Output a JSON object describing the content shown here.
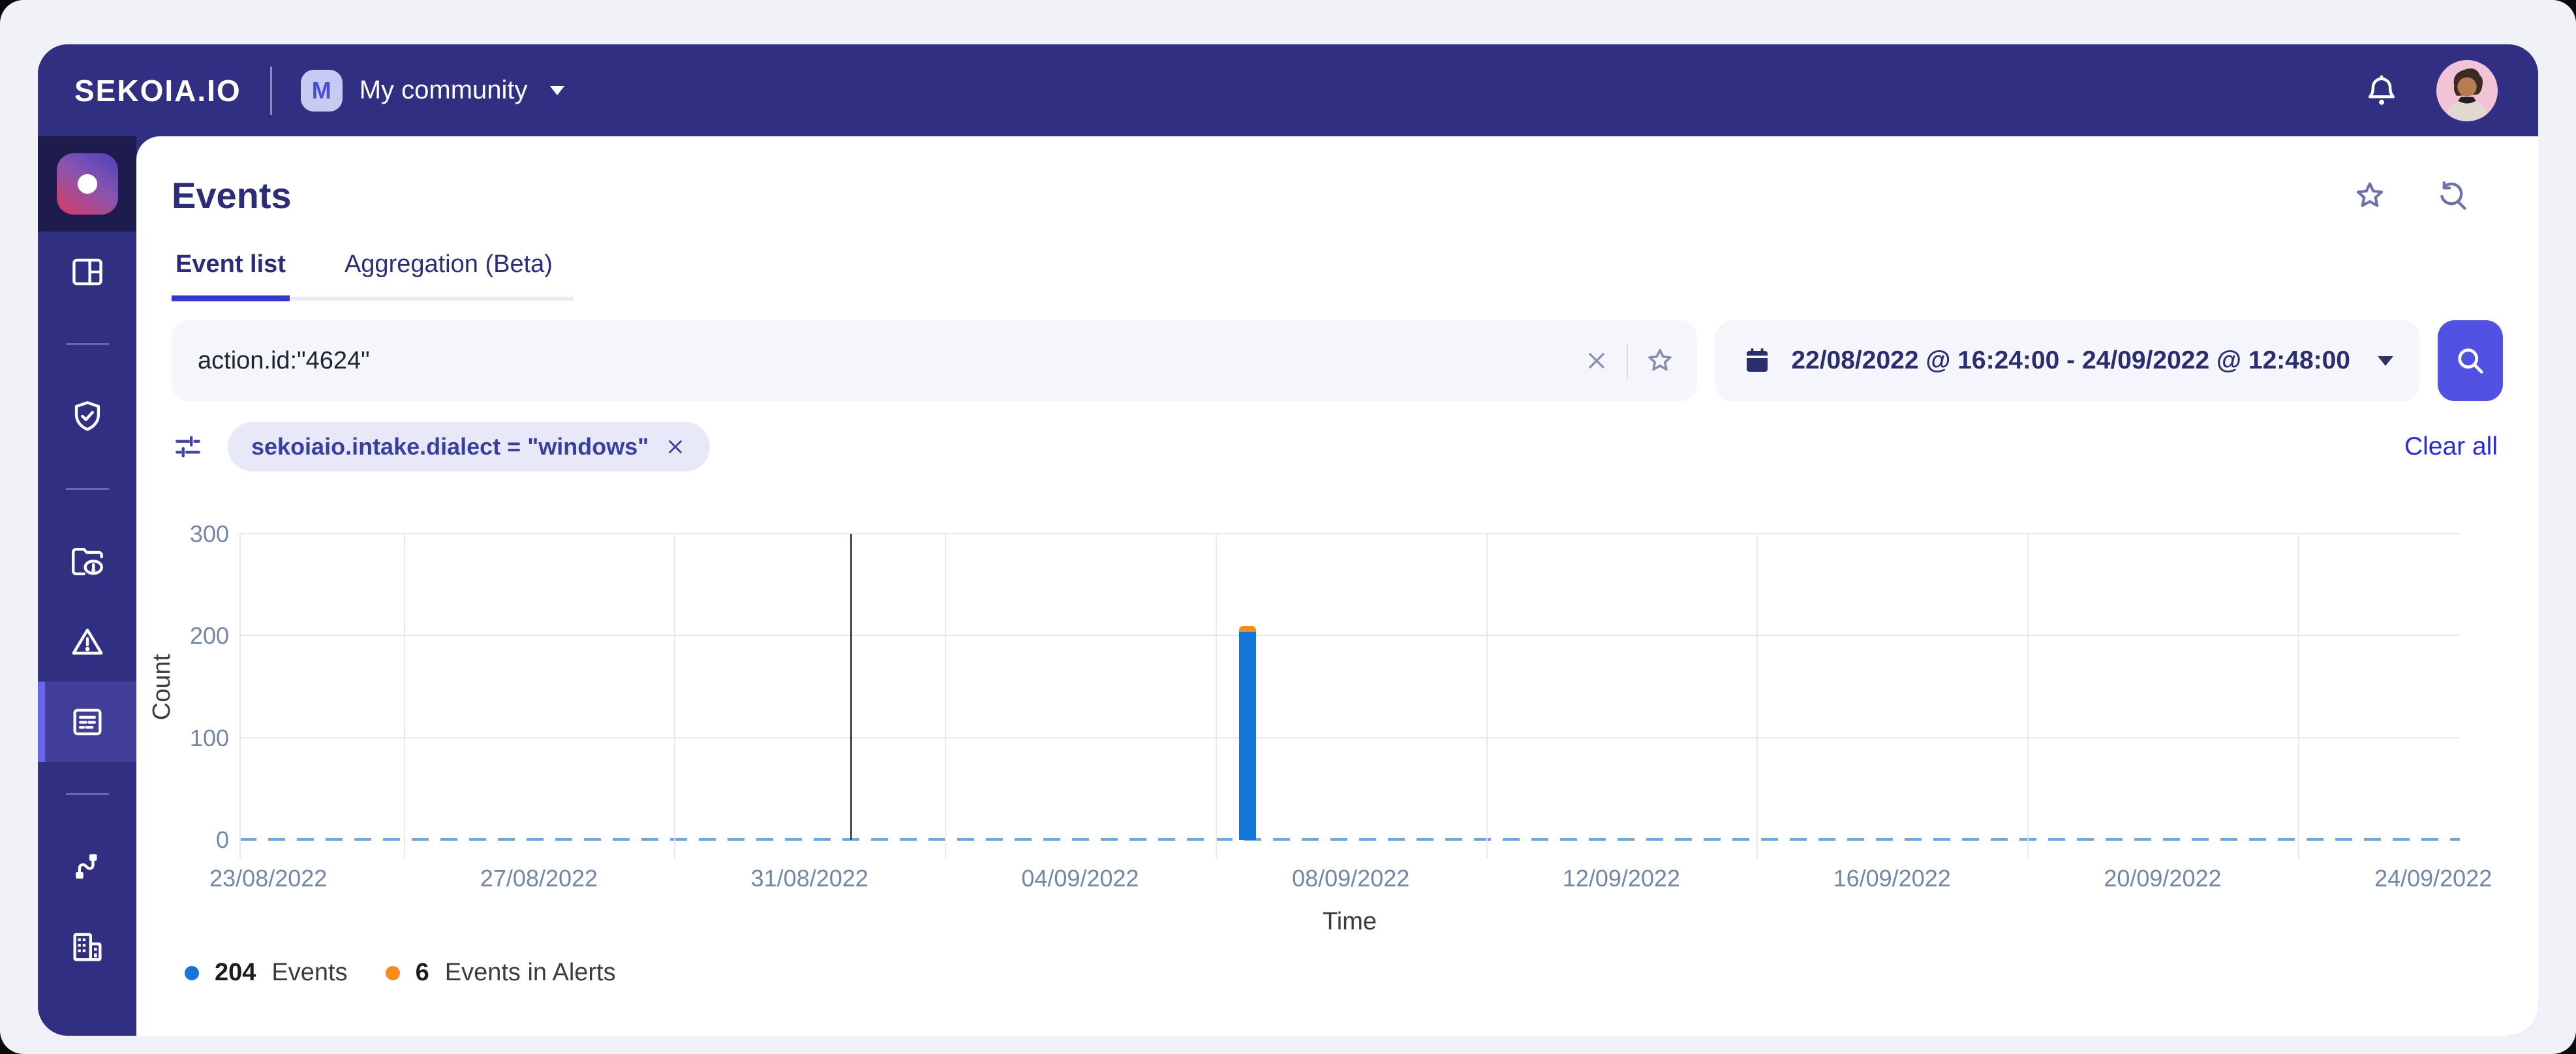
{
  "topbar": {
    "brand": "SEKOIA.IO",
    "community_initial": "M",
    "community_name": "My community",
    "icons": [
      "bell-icon",
      "user-avatar"
    ]
  },
  "sidebar": {
    "icons": [
      "app-logo",
      "dashboard-icon",
      "shield-check-icon",
      "folder-alert-icon",
      "alert-triangle-icon",
      "events-list-icon",
      "intake-plug-icon",
      "organization-building-icon"
    ],
    "active_icon": "events-list-icon"
  },
  "header": {
    "title": "Events",
    "icons": [
      "star-icon",
      "search-history-icon"
    ]
  },
  "tabs": [
    {
      "label": "Event list",
      "active": true
    },
    {
      "label": "Aggregation (Beta)",
      "active": false
    }
  ],
  "search": {
    "query": "action.id:\"4624\"",
    "date_range": "22/08/2022 @ 16:24:00 - 24/09/2022 @ 12:48:00",
    "icons": [
      "clear-x-icon",
      "star-icon",
      "calendar-icon",
      "chevron-down-icon",
      "magnifier-icon"
    ]
  },
  "filters": {
    "filter_icon": "tune-sliders-icon",
    "chips": [
      {
        "label": "sekoiaio.intake.dialect = \"windows\"",
        "remove_icon": "x-icon"
      }
    ],
    "clear_all_label": "Clear all"
  },
  "chart_data": {
    "type": "bar",
    "title": "",
    "xlabel": "Time",
    "ylabel": "Count",
    "ylim": [
      0,
      300
    ],
    "y_ticks": [
      0,
      100,
      200,
      300
    ],
    "x_ticks": [
      "23/08/2022",
      "27/08/2022",
      "31/08/2022",
      "04/09/2022",
      "08/09/2022",
      "12/09/2022",
      "16/09/2022",
      "20/09/2022",
      "24/09/2022"
    ],
    "x_axis": {
      "first_tick_pct": 1.3,
      "tick_step_pct": 12.1875
    },
    "grid": true,
    "zero_line_style": "dashed-light-blue",
    "annotation_line_x_pct": 27.5,
    "series": [
      {
        "name": "Events",
        "color": "#1476DB",
        "total": 204
      },
      {
        "name": "Events in Alerts",
        "color": "#F78B1D",
        "total": 6
      }
    ],
    "bars": [
      {
        "date": "06/09/2022",
        "events": 204,
        "events_in_alerts": 6,
        "x_pct": 45.4
      }
    ],
    "legend_position": "bottom-left",
    "legend": [
      {
        "value": "204",
        "label": "Events",
        "color": "#1476DB"
      },
      {
        "value": "6",
        "label": "Events in Alerts",
        "color": "#F78B1D"
      }
    ]
  },
  "colors": {
    "topbar": "#312F81",
    "active_item": "#403E99",
    "accent_bar": "#6765F0",
    "primary_button": "#5152E3",
    "title_text": "#2B2D77",
    "chip_bg": "#E7E9F8",
    "bar_blue": "#1476DB",
    "bar_orange": "#F78B1D"
  }
}
